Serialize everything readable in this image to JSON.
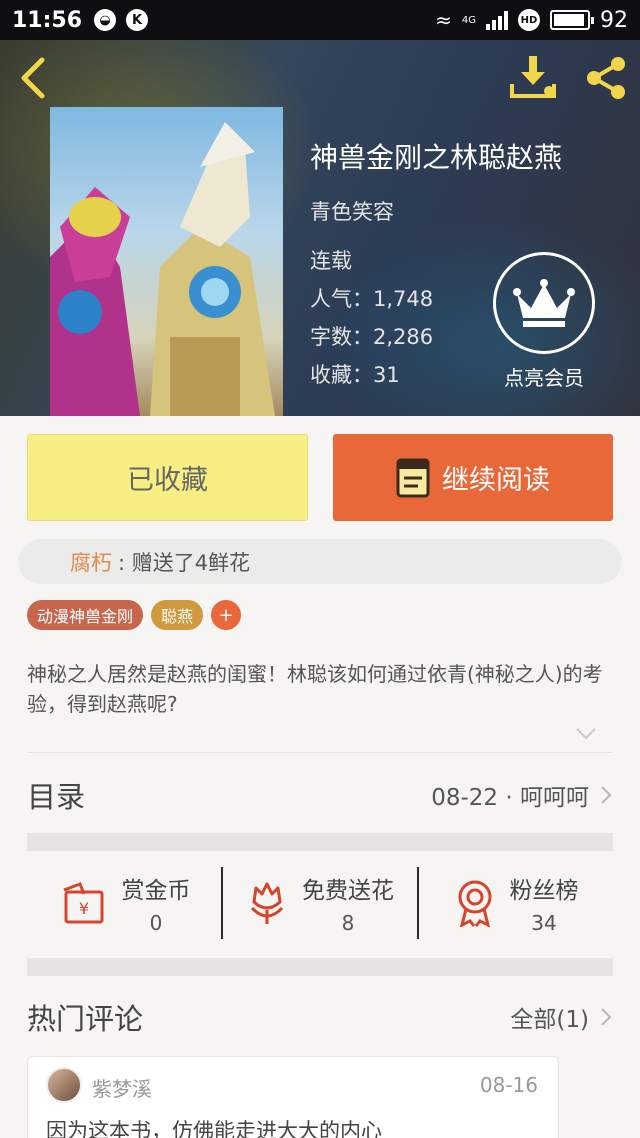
{
  "status_bar": {
    "time": "11:56",
    "battery": "92",
    "network": "4G",
    "hd": "HD",
    "notif_k": "K"
  },
  "book": {
    "title": "神兽金刚之林聪赵燕",
    "author": "青色笑容",
    "status": "连载",
    "popularity": "人气：1,748",
    "words": "字数：2,286",
    "favorites": "收藏：31",
    "member_label": "点亮会员"
  },
  "actions": {
    "collected_label": "已收藏",
    "continue_label": "继续阅读"
  },
  "gift": {
    "user": "腐朽",
    "text": ": 赠送了4鲜花"
  },
  "tags": [
    "动漫神兽金刚",
    "聪燕"
  ],
  "tag_add": "+",
  "description": "神秘之人居然是赵燕的闺蜜！林聪该如何通过依青(神秘之人)的考验，得到赵燕呢?",
  "toc": {
    "title": "目录",
    "latest": "08-22 · 呵呵呵"
  },
  "stats": [
    {
      "label": "赏金币",
      "value": "0",
      "icon": "coin-envelope-icon"
    },
    {
      "label": "免费送花",
      "value": "8",
      "icon": "flower-icon"
    },
    {
      "label": "粉丝榜",
      "value": "34",
      "icon": "medal-icon"
    }
  ],
  "hot_comments": {
    "title": "热门评论",
    "all": "全部(1)"
  },
  "comment": {
    "user": "紫梦溪",
    "date": "08-16",
    "text": "因为这本书，仿佛能走进大大的内心"
  },
  "colors": {
    "accent_orange": "#e8683a",
    "collected_yellow": "#f8ef84",
    "icon_red": "#d6452b",
    "header_icon_yellow": "#f2d64a"
  }
}
